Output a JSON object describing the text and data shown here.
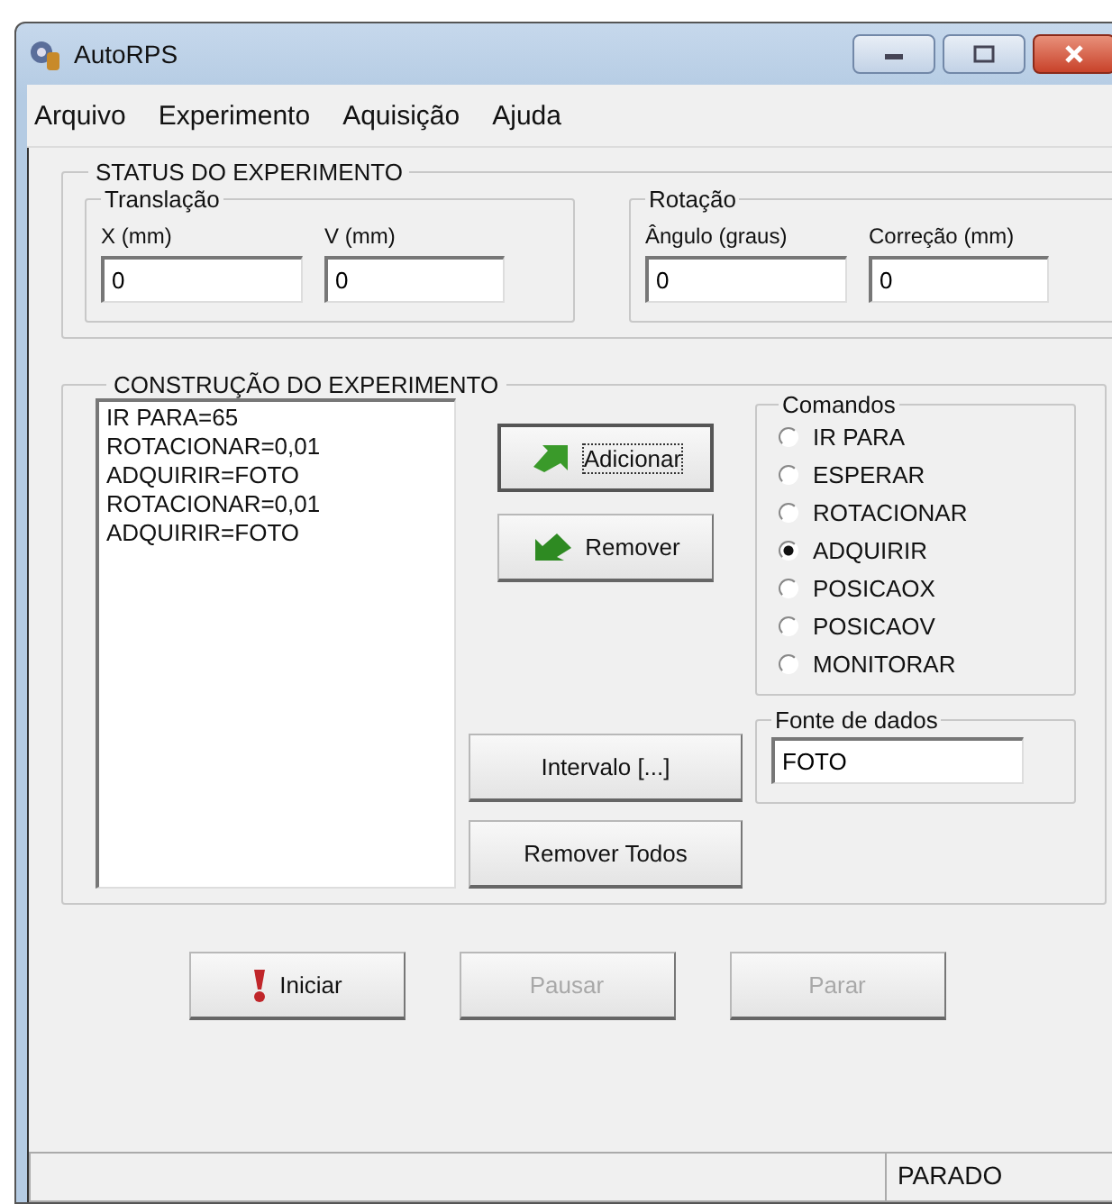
{
  "window": {
    "title": "AutoRPS"
  },
  "menu": [
    "Arquivo",
    "Experimento",
    "Aquisição",
    "Ajuda"
  ],
  "status": {
    "title": "STATUS DO EXPERIMENTO",
    "groups": [
      {
        "title": "Translação",
        "fields": [
          {
            "label": "X (mm)",
            "value": "0"
          },
          {
            "label": "V (mm)",
            "value": "0"
          }
        ]
      },
      {
        "title": "Rotação",
        "fields": [
          {
            "label": "Ângulo (graus)",
            "value": "0"
          },
          {
            "label": "Correção (mm)",
            "value": "0"
          }
        ]
      }
    ]
  },
  "construction": {
    "title": "CONSTRUÇÃO DO EXPERIMENTO",
    "list": [
      "IR PARA=65",
      "ROTACIONAR=0,01",
      "ADQUIRIR=FOTO",
      "ROTACIONAR=0,01",
      "ADQUIRIR=FOTO"
    ],
    "add_button": {
      "label": "Adicionar",
      "focused": true
    },
    "remove_button": {
      "label": "Remover"
    },
    "interval_button": "Intervalo [...]",
    "remove_all_button": "Remover Todos",
    "commands": {
      "title": "Comandos",
      "options": [
        {
          "label": "IR PARA",
          "selected": false
        },
        {
          "label": "ESPERAR",
          "selected": false
        },
        {
          "label": "ROTACIONAR",
          "selected": false
        },
        {
          "label": "ADQUIRIR",
          "selected": true
        },
        {
          "label": "POSICAOX",
          "selected": false
        },
        {
          "label": "POSICAOV",
          "selected": false
        },
        {
          "label": "MONITORAR",
          "selected": false
        }
      ]
    },
    "data_source": {
      "title": "Fonte de dados",
      "value": "FOTO"
    }
  },
  "actions": [
    {
      "label": "Iniciar",
      "disabled": false,
      "icon": true
    },
    {
      "label": "Pausar",
      "disabled": true,
      "icon": false
    },
    {
      "label": "Parar",
      "disabled": true,
      "icon": false
    }
  ],
  "status_bar": {
    "state": "PARADO"
  }
}
